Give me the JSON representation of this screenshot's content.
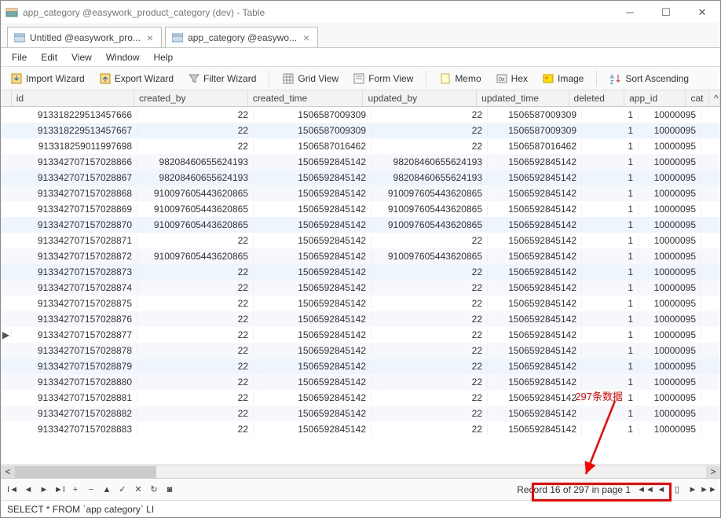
{
  "window": {
    "title": "app_category @easywork_product_category (dev) - Table"
  },
  "tabs": [
    {
      "label": "Untitled @easywork_pro..."
    },
    {
      "label": "app_category @easywo..."
    }
  ],
  "menu": {
    "file": "File",
    "edit": "Edit",
    "view": "View",
    "window": "Window",
    "help": "Help"
  },
  "toolbar": {
    "import": "Import Wizard",
    "export": "Export Wizard",
    "filter": "Filter Wizard",
    "grid": "Grid View",
    "form": "Form View",
    "memo": "Memo",
    "hex": "Hex",
    "image": "Image",
    "sort": "Sort Ascending"
  },
  "columns": {
    "id": "id",
    "created_by": "created_by",
    "created_time": "created_time",
    "updated_by": "updated_by",
    "updated_time": "updated_time",
    "deleted": "deleted",
    "app_id": "app_id",
    "cat": "cat"
  },
  "rows": [
    {
      "id": "913318229513457666",
      "cb": "22",
      "ct": "1506587009309",
      "ub": "22",
      "ut": "1506587009309",
      "del": "1",
      "app": "10000095"
    },
    {
      "id": "913318229513457667",
      "cb": "22",
      "ct": "1506587009309",
      "ub": "22",
      "ut": "1506587009309",
      "del": "1",
      "app": "10000095"
    },
    {
      "id": "913318259011997698",
      "cb": "22",
      "ct": "1506587016462",
      "ub": "22",
      "ut": "1506587016462",
      "del": "1",
      "app": "10000095"
    },
    {
      "id": "913342707157028866",
      "cb": "98208460655624193",
      "ct": "1506592845142",
      "ub": "98208460655624193",
      "ut": "1506592845142",
      "del": "1",
      "app": "10000095"
    },
    {
      "id": "913342707157028867",
      "cb": "98208460655624193",
      "ct": "1506592845142",
      "ub": "98208460655624193",
      "ut": "1506592845142",
      "del": "1",
      "app": "10000095"
    },
    {
      "id": "913342707157028868",
      "cb": "910097605443620865",
      "ct": "1506592845142",
      "ub": "910097605443620865",
      "ut": "1506592845142",
      "del": "1",
      "app": "10000095"
    },
    {
      "id": "913342707157028869",
      "cb": "910097605443620865",
      "ct": "1506592845142",
      "ub": "910097605443620865",
      "ut": "1506592845142",
      "del": "1",
      "app": "10000095"
    },
    {
      "id": "913342707157028870",
      "cb": "910097605443620865",
      "ct": "1506592845142",
      "ub": "910097605443620865",
      "ut": "1506592845142",
      "del": "1",
      "app": "10000095"
    },
    {
      "id": "913342707157028871",
      "cb": "22",
      "ct": "1506592845142",
      "ub": "22",
      "ut": "1506592845142",
      "del": "1",
      "app": "10000095"
    },
    {
      "id": "913342707157028872",
      "cb": "910097605443620865",
      "ct": "1506592845142",
      "ub": "910097605443620865",
      "ut": "1506592845142",
      "del": "1",
      "app": "10000095"
    },
    {
      "id": "913342707157028873",
      "cb": "22",
      "ct": "1506592845142",
      "ub": "22",
      "ut": "1506592845142",
      "del": "1",
      "app": "10000095"
    },
    {
      "id": "913342707157028874",
      "cb": "22",
      "ct": "1506592845142",
      "ub": "22",
      "ut": "1506592845142",
      "del": "1",
      "app": "10000095"
    },
    {
      "id": "913342707157028875",
      "cb": "22",
      "ct": "1506592845142",
      "ub": "22",
      "ut": "1506592845142",
      "del": "1",
      "app": "10000095"
    },
    {
      "id": "913342707157028876",
      "cb": "22",
      "ct": "1506592845142",
      "ub": "22",
      "ut": "1506592845142",
      "del": "1",
      "app": "10000095"
    },
    {
      "id": "913342707157028877",
      "cb": "22",
      "ct": "1506592845142",
      "ub": "22",
      "ut": "1506592845142",
      "del": "1",
      "app": "10000095"
    },
    {
      "id": "913342707157028878",
      "cb": "22",
      "ct": "1506592845142",
      "ub": "22",
      "ut": "1506592845142",
      "del": "1",
      "app": "10000095"
    },
    {
      "id": "913342707157028879",
      "cb": "22",
      "ct": "1506592845142",
      "ub": "22",
      "ut": "1506592845142",
      "del": "1",
      "app": "10000095"
    },
    {
      "id": "913342707157028880",
      "cb": "22",
      "ct": "1506592845142",
      "ub": "22",
      "ut": "1506592845142",
      "del": "1",
      "app": "10000095"
    },
    {
      "id": "913342707157028881",
      "cb": "22",
      "ct": "1506592845142",
      "ub": "22",
      "ut": "1506592845142",
      "del": "1",
      "app": "10000095"
    },
    {
      "id": "913342707157028882",
      "cb": "22",
      "ct": "1506592845142",
      "ub": "22",
      "ut": "1506592845142",
      "del": "1",
      "app": "10000095"
    },
    {
      "id": "913342707157028883",
      "cb": "22",
      "ct": "1506592845142",
      "ub": "22",
      "ut": "1506592845142",
      "del": "1",
      "app": "10000095"
    }
  ],
  "current_row_index": 14,
  "alt_rows": [
    1,
    4,
    7,
    10,
    16
  ],
  "annotation": "297条数据",
  "record_status": "Record 16 of 297 in page 1",
  "sql": "SELECT * FROM `app category` LI",
  "scroll_up": "^"
}
